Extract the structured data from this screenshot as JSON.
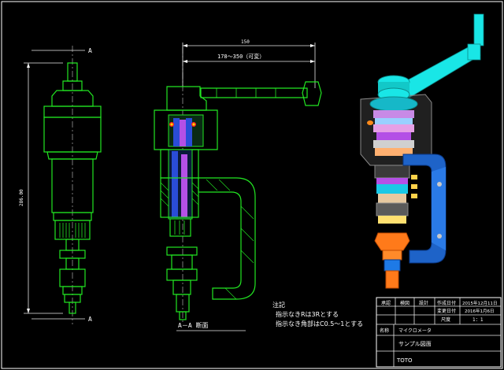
{
  "views": {
    "front_section_marker_top": "A",
    "front_section_marker_bottom": "A",
    "overall_height_dim": "286.00",
    "span_dim": "150",
    "stroke_dim": "178～350（可変）",
    "section_title": "A－A 断面"
  },
  "notes": {
    "heading": "注記",
    "line1": "指示なきRは3Rとする",
    "line2": "指示なき角部はC0.5～1とする"
  },
  "title_block": {
    "header_cells": [
      "承認",
      "検図",
      "設計",
      "作成日付",
      "2015年12月11日"
    ],
    "row2_label": "変更日付",
    "row2_value": "2016年1月6日",
    "row3_label": "尺度",
    "row3_value": "1：1",
    "product_label": "名称",
    "product_value": "マイクロメータ",
    "drawing_title": "サンプル図面",
    "company": "TOTO"
  },
  "colors": {
    "background": "#000000",
    "outline": "#22e622",
    "dimension": "#ffffff",
    "cyan_part": "#19e6e6",
    "blue_frame": "#1e63c8",
    "orange_part": "#ff7a1a",
    "purple_part": "#b450e6"
  }
}
